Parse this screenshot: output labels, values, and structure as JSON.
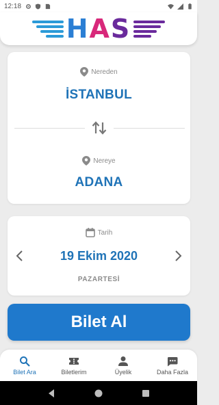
{
  "status_bar": {
    "time": "12:18"
  },
  "header": {
    "logo_text": "HAS",
    "colors": {
      "blue": "#2b7fd4",
      "pink": "#d8287a",
      "purple": "#6a2a9c"
    }
  },
  "route": {
    "from_label": "Nereden",
    "from_city": "İSTANBUL",
    "to_label": "Nereye",
    "to_city": "ADANA",
    "swap_icon": "swap-vertical-icon"
  },
  "date": {
    "label": "Tarih",
    "value": "19 Ekim 2020",
    "day": "PAZARTESİ",
    "prev_icon": "chevron-left-icon",
    "next_icon": "chevron-right-icon"
  },
  "buy_button": {
    "label": "Bilet Al",
    "color": "#1f79cc"
  },
  "bottom_nav": {
    "items": [
      {
        "label": "Bilet Ara",
        "icon": "search-icon",
        "active": true
      },
      {
        "label": "Biletlerim",
        "icon": "ticket-icon",
        "active": false
      },
      {
        "label": "Üyelik",
        "icon": "person-icon",
        "active": false
      },
      {
        "label": "Daha Fazla",
        "icon": "more-icon",
        "active": false
      }
    ]
  },
  "accent_color": "#1f73b7"
}
